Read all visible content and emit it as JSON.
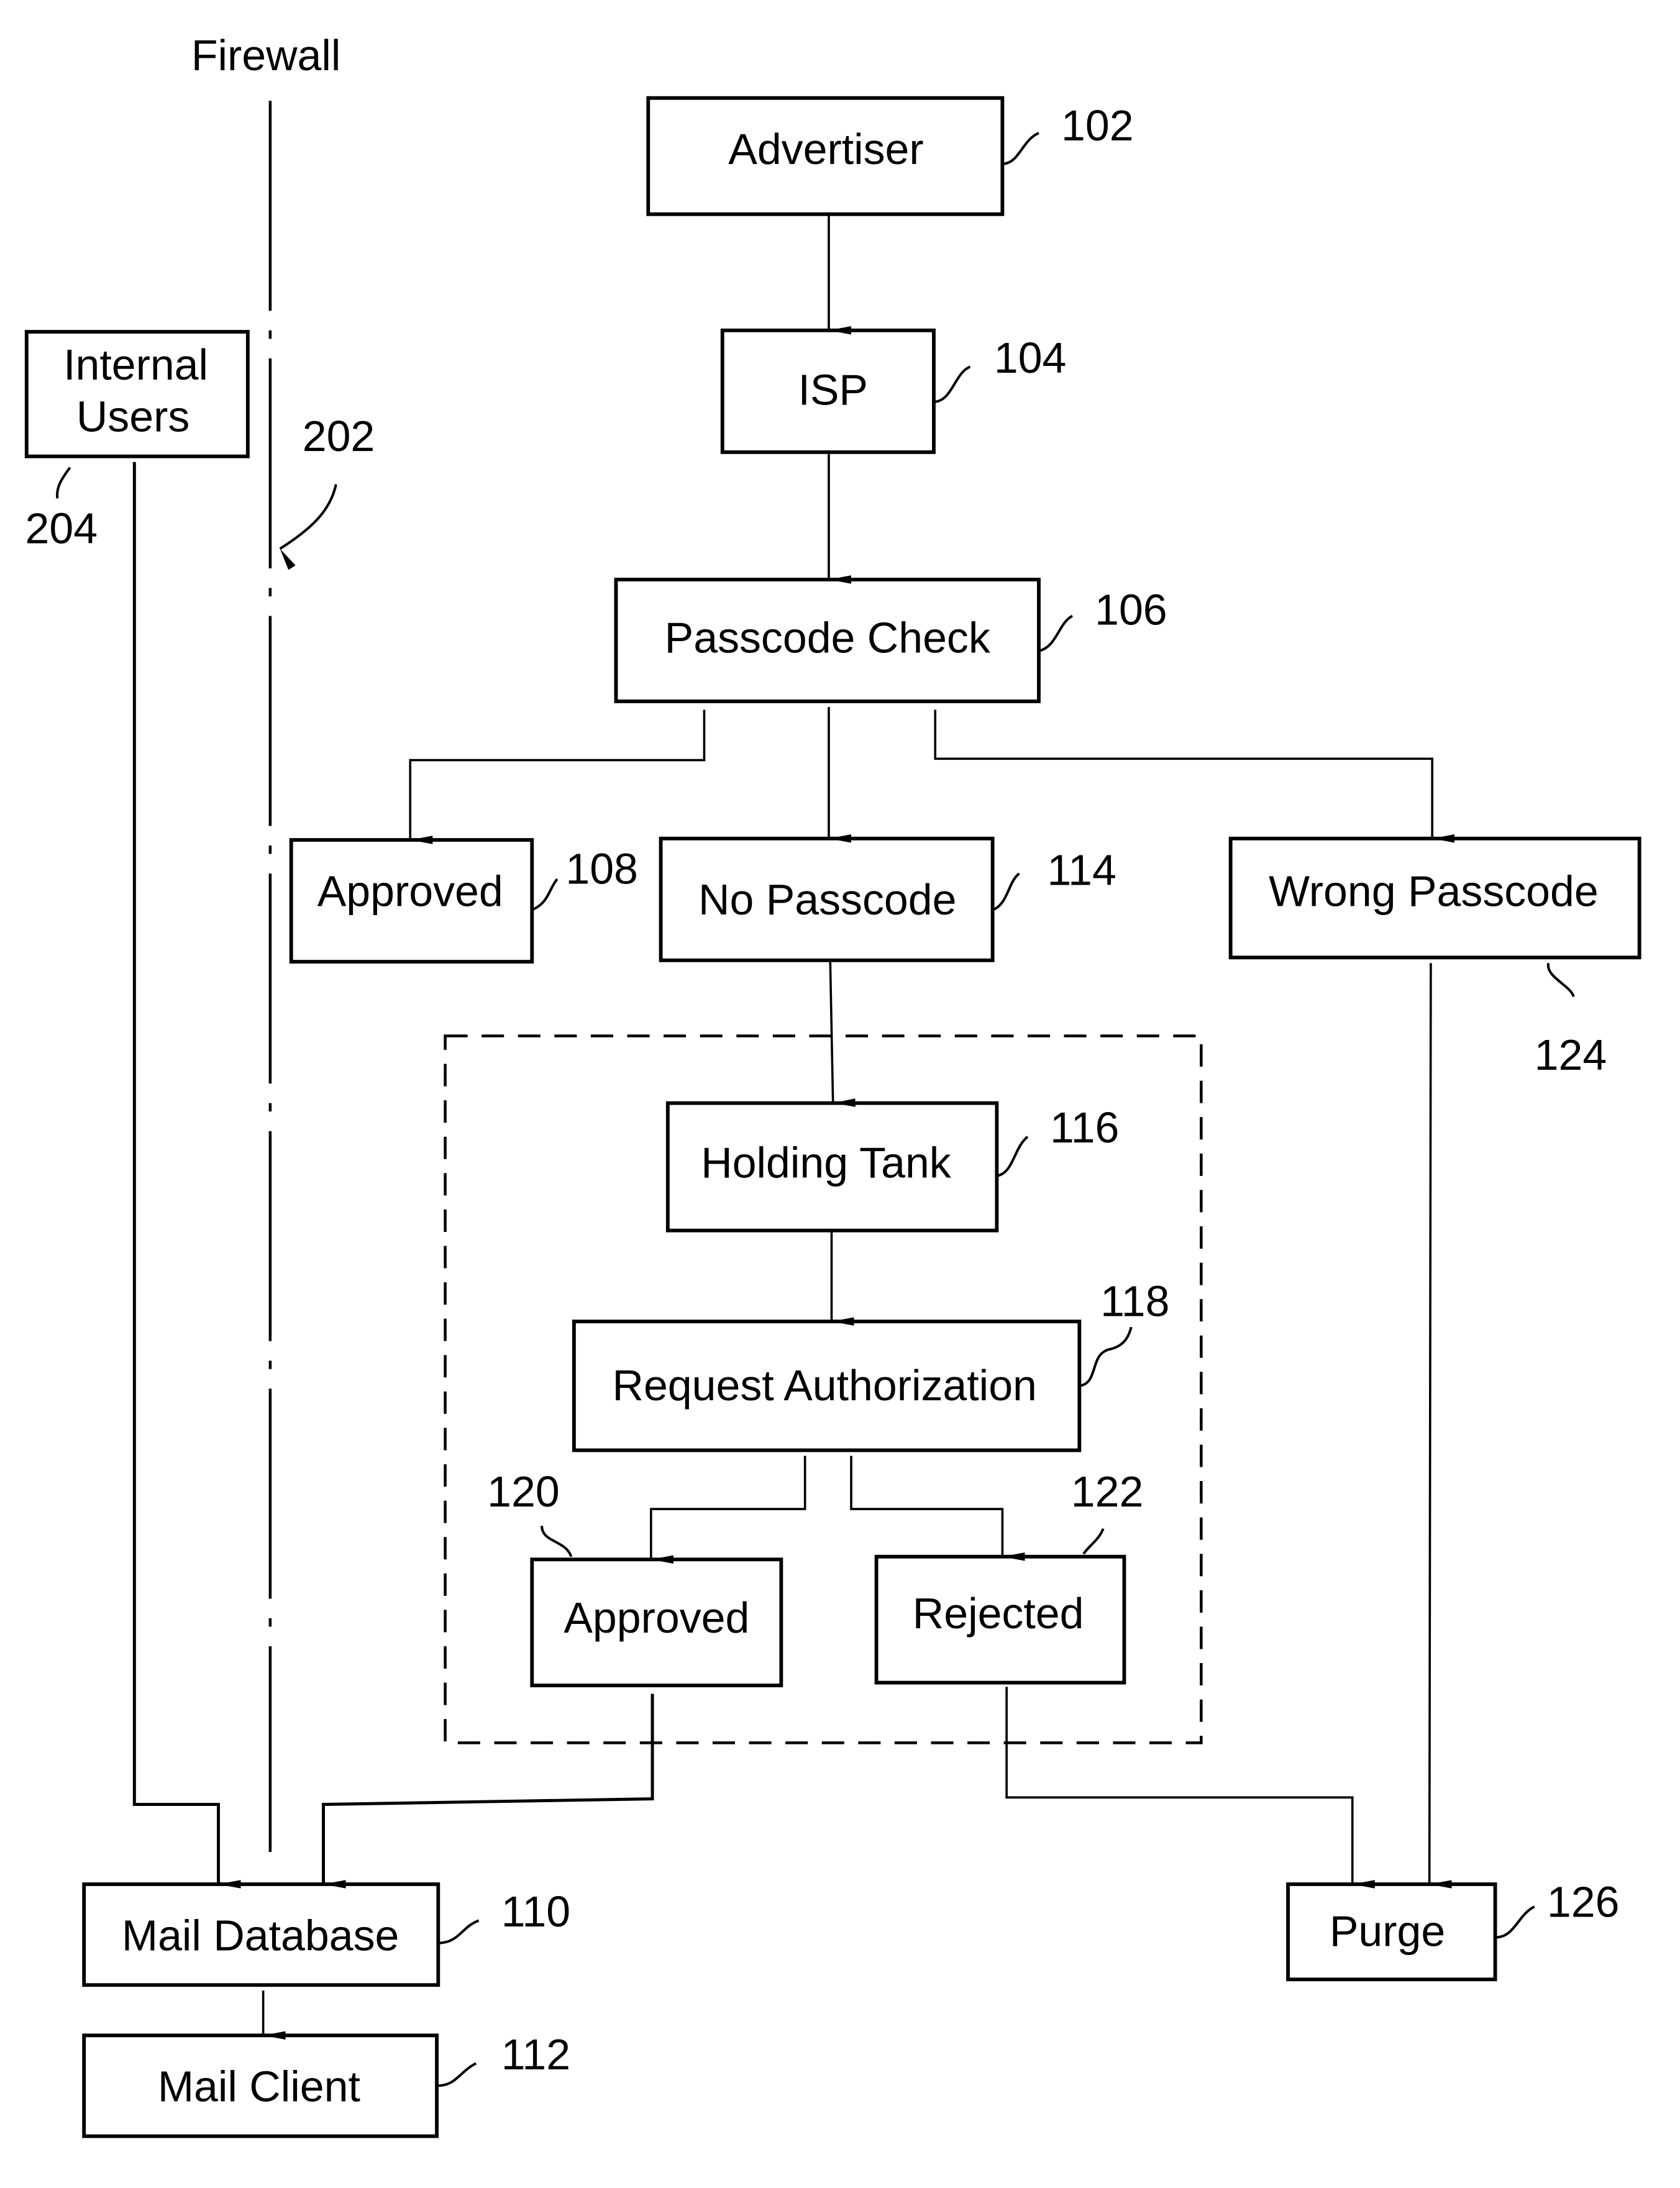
{
  "figure": {
    "firewall_label": "Firewall",
    "nodes": {
      "advertiser": {
        "label": "Advertiser",
        "ref": "102"
      },
      "isp": {
        "label": "ISP",
        "ref": "104"
      },
      "passcode_check": {
        "label": "Passcode Check",
        "ref": "106"
      },
      "approved_direct": {
        "label": "Approved",
        "ref": "108"
      },
      "no_passcode": {
        "label": "No Passcode",
        "ref": "114"
      },
      "wrong_passcode": {
        "label": "Wrong Passcode",
        "ref": "124"
      },
      "holding_tank": {
        "label": "Holding Tank",
        "ref": "116"
      },
      "request_authorization": {
        "label": "Request Authorization",
        "ref": "118"
      },
      "approved_auth": {
        "label": "Approved",
        "ref": "120"
      },
      "rejected": {
        "label": "Rejected",
        "ref": "122"
      },
      "mail_database": {
        "label": "Mail Database",
        "ref": "110"
      },
      "mail_client": {
        "label": "Mail Client",
        "ref": "112"
      },
      "purge": {
        "label": "Purge",
        "ref": "126"
      },
      "internal_users": {
        "label_line1": "Internal",
        "label_line2": "Users",
        "ref": "204"
      }
    },
    "firewall_ref": "202",
    "edges": [
      [
        "Advertiser",
        "ISP"
      ],
      [
        "ISP",
        "Passcode Check"
      ],
      [
        "Passcode Check",
        "Approved (108)"
      ],
      [
        "Passcode Check",
        "No Passcode"
      ],
      [
        "Passcode Check",
        "Wrong Passcode"
      ],
      [
        "No Passcode",
        "Holding Tank"
      ],
      [
        "Holding Tank",
        "Request Authorization"
      ],
      [
        "Request Authorization",
        "Approved (120)"
      ],
      [
        "Request Authorization",
        "Rejected"
      ],
      [
        "Approved (120)",
        "Mail Database"
      ],
      [
        "Internal Users",
        "Mail Database"
      ],
      [
        "Rejected",
        "Purge"
      ],
      [
        "Wrong Passcode",
        "Purge"
      ],
      [
        "Mail Database",
        "Mail Client"
      ]
    ]
  }
}
